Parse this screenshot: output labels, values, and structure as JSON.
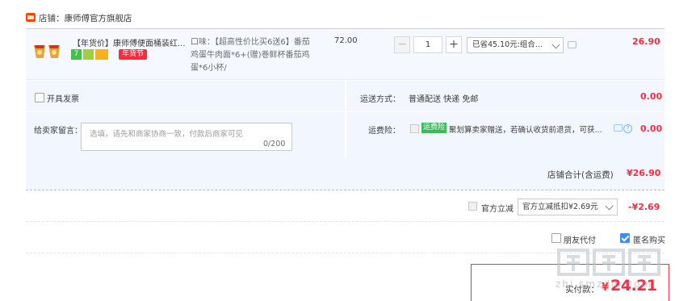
{
  "store": {
    "icon": "tmall-store-icon",
    "label": "店铺：康师傅官方旗舰店"
  },
  "item": {
    "title": "【年货价】康师傅便面桶装红...",
    "badge_year": "年货节",
    "sku": "口味：【超高性价比买6送6】番茄鸡蛋牛肉面*6+(赠)巻鲜杯番茄鸡蛋*6小杯/",
    "unit_price": "72.00",
    "quantity": "1",
    "qty_minus": "−",
    "qty_plus": "+",
    "promo": "已省45.10元:组合...",
    "total": "26.90"
  },
  "invoice": {
    "label": "开具发票"
  },
  "shipping": {
    "label": "运送方式：",
    "value": "普通配送 快递 免邮",
    "fee": "0.00"
  },
  "message": {
    "label": "给卖家留言：",
    "placeholder": "选填，请先和商家协商一致，付款后商家可见",
    "count": "0/200"
  },
  "insurance": {
    "label": "运费险：",
    "badge": "运费险",
    "text": "聚划算卖家赠送，若确认收货前退货，可获...",
    "fee": "0.00",
    "help": "?"
  },
  "store_total": {
    "label": "店铺合计(含运费)",
    "value": "¥26.90"
  },
  "discount": {
    "label": "官方立减",
    "select": "官方立减抵扣¥2.69元",
    "value": "-¥2.69"
  },
  "options": {
    "friend_pay": "朋友代付",
    "anonymous": "匿名购买"
  },
  "grand_total": {
    "label": "实付款：",
    "currency": "¥",
    "value": "24.21"
  },
  "watermark": "zhi.smzdm.com",
  "colors": {
    "accent_red": "#ff2b3d",
    "panel_blue": "#f2f7ff",
    "border_blue": "#b2d1ff",
    "check_blue": "#3b8cff"
  }
}
